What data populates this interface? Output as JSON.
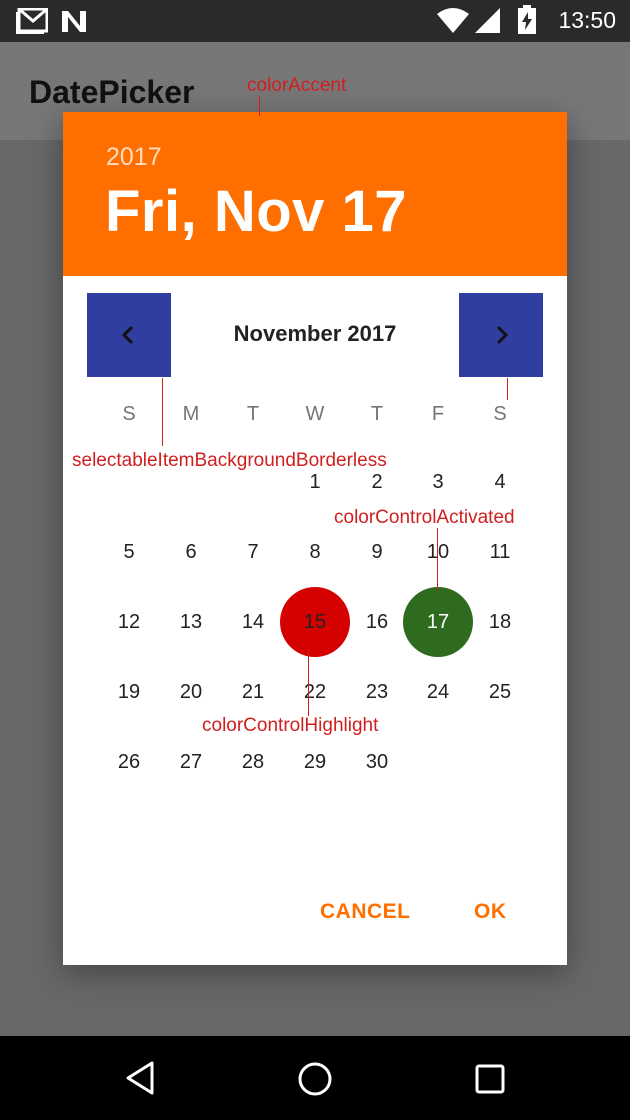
{
  "colors": {
    "accent": "#FF6F00",
    "control_activated": "#2E6B1E",
    "control_highlight": "#D50000",
    "nav_button_bg": "#303F9F",
    "annotation": "#D11F1F"
  },
  "status_bar": {
    "time": "13:50",
    "icons": [
      "gmail-icon",
      "n-icon",
      "wifi-icon",
      "signal-icon",
      "battery-charging-icon"
    ]
  },
  "app_bar": {
    "title": "DatePicker"
  },
  "dialog": {
    "header": {
      "year": "2017",
      "date": "Fri, Nov 17"
    },
    "month_title": "November 2017",
    "prev_icon": "chevron-left-icon",
    "next_icon": "chevron-right-icon",
    "weekdays": [
      "S",
      "M",
      "T",
      "W",
      "T",
      "F",
      "S"
    ],
    "first_weekday_index": 3,
    "days_in_month": 30,
    "selected_day": 17,
    "pressed_day": 15,
    "actions": {
      "cancel": "CANCEL",
      "ok": "OK"
    }
  },
  "annotations": {
    "color_accent": "colorAccent",
    "selectable_item_background": "selectableItemBackgroundBorderless",
    "color_control_activated": "colorControlActivated",
    "color_control_highlight": "colorControlHighlight"
  },
  "nav_bar": {
    "icons": [
      "back-icon",
      "home-icon",
      "recents-icon"
    ]
  }
}
